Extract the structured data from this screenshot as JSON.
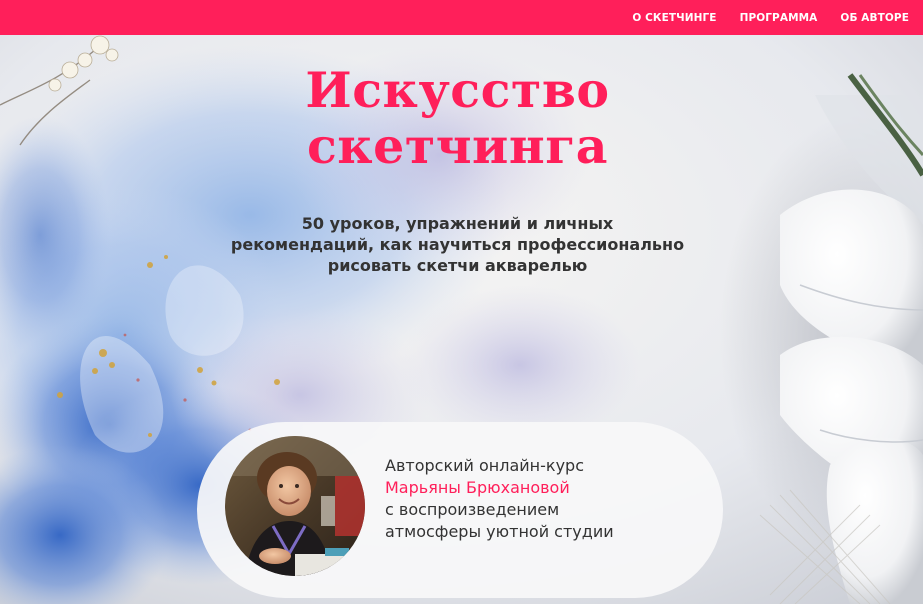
{
  "nav": {
    "items": [
      "О СКЕТЧИНГЕ",
      "ПРОГРАММА",
      "ОБ АВТОРЕ"
    ]
  },
  "hero": {
    "title_lines": [
      "Искусство",
      "скетчинга"
    ],
    "subtitle_lines": [
      "50 уроков, упражнений и личных",
      "рекомендаций, как научиться профессионально",
      "рисовать скетчи акварелью"
    ]
  },
  "author": {
    "lines": [
      "Авторский онлайн-курс",
      "Марьяны Брюхановой",
      "с воспроизведением",
      "атмосферы уютной студии"
    ]
  },
  "colors": {
    "accent": "#ff1f5a",
    "text": "#333333"
  },
  "icons": {
    "background": "watercolor-flowers-background",
    "avatar": "author-photo"
  }
}
